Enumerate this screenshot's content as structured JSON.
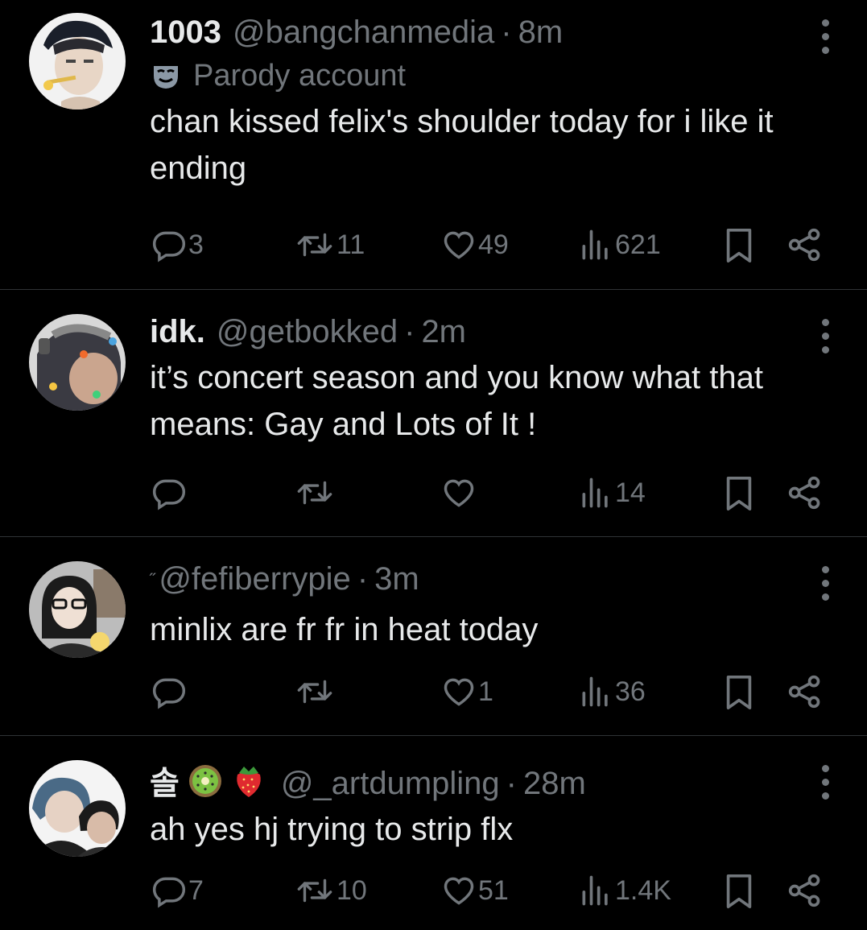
{
  "tweets": [
    {
      "name": "1003",
      "handle": "@bangchanmedia",
      "time": "8m",
      "parody_label": "Parody account",
      "text": "chan kissed felix's shoulder today for i like it ending",
      "replies": "3",
      "reposts": "11",
      "likes": "49",
      "views": "621"
    },
    {
      "name": "idk.",
      "handle": "@getbokked",
      "time": "2m",
      "text": "it’s concert season and you know what that means: Gay and Lots of It !",
      "replies": "",
      "reposts": "",
      "likes": "",
      "views": "14"
    },
    {
      "name": "˶",
      "handle": "@fefiberrypie",
      "time": "3m",
      "text": "minlix are fr fr in heat today",
      "replies": "",
      "reposts": "",
      "likes": "1",
      "views": "36"
    },
    {
      "name": "솔",
      "name_emojis": [
        "kiwi-emoji",
        "strawberry-emoji"
      ],
      "handle": "@_artdumpling",
      "time": "28m",
      "text": "ah yes hj trying to strip flx",
      "replies": "7",
      "reposts": "10",
      "likes": "51",
      "views": "1.4K"
    }
  ],
  "separator": "·",
  "colors": {
    "background": "#000000",
    "primary_text": "#e7e9ea",
    "secondary_text": "#71767b",
    "divider": "#2f3336"
  }
}
